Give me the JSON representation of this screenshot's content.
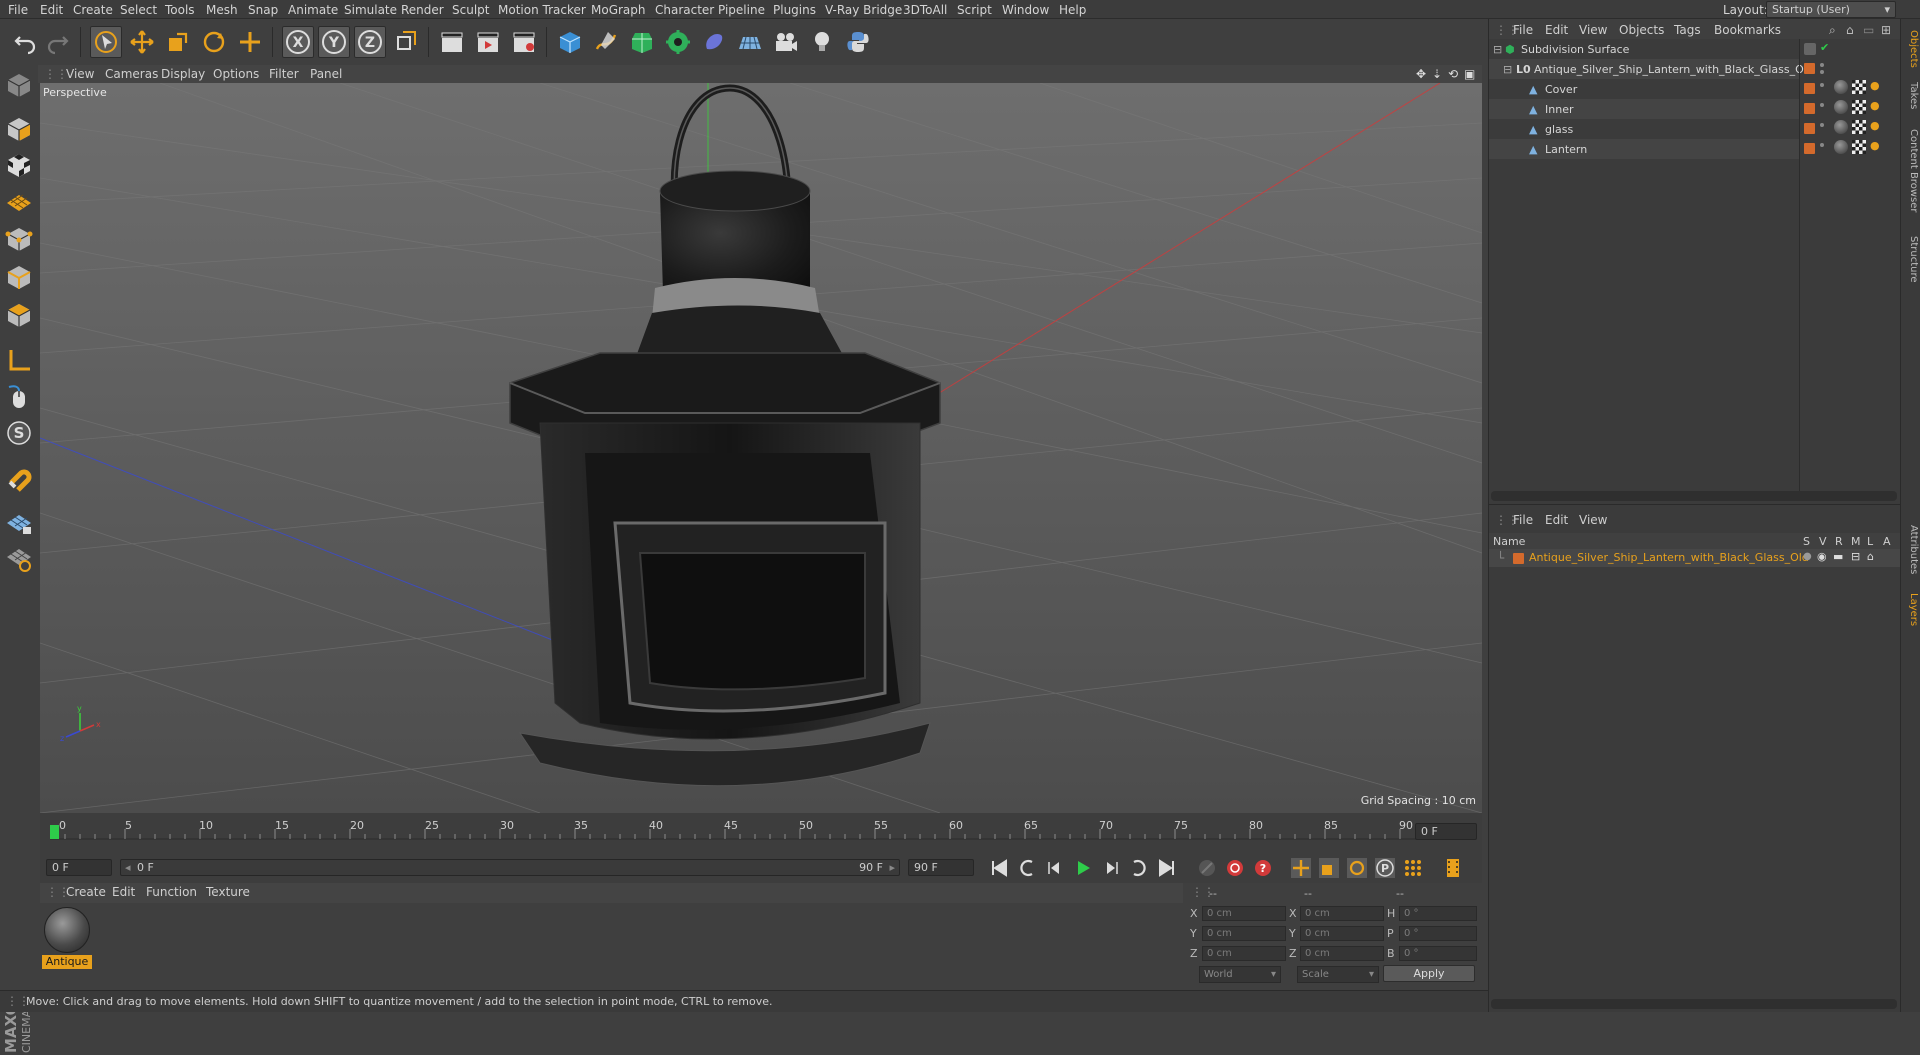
{
  "menu": [
    "File",
    "Edit",
    "Create",
    "Select",
    "Tools",
    "Mesh",
    "Snap",
    "Animate",
    "Simulate",
    "Render",
    "Sculpt",
    "Motion Tracker",
    "MoGraph",
    "Character",
    "Pipeline",
    "Plugins",
    "V-Ray Bridge",
    "3DToAll",
    "Script",
    "Window",
    "Help"
  ],
  "layout": {
    "label": "Layout:",
    "value": "Startup (User)"
  },
  "viewport": {
    "menu": [
      "View",
      "Cameras",
      "Display",
      "Options",
      "Filter",
      "Panel"
    ],
    "label": "Perspective",
    "grid_spacing": "Grid Spacing : 10 cm"
  },
  "timeline": {
    "ticks": [
      "0",
      "5",
      "10",
      "15",
      "20",
      "25",
      "30",
      "35",
      "40",
      "45",
      "50",
      "55",
      "60",
      "65",
      "70",
      "75",
      "80",
      "85",
      "90"
    ],
    "current_frame_field": "0 F",
    "start_field": "0 F",
    "range_start": "0 F",
    "range_end": "90 F",
    "end_field": "90 F"
  },
  "material": {
    "menu": [
      "Create",
      "Edit",
      "Function",
      "Texture"
    ],
    "name": "Antique"
  },
  "coords": {
    "header": [
      "--",
      "--",
      "--"
    ],
    "rows": [
      {
        "a": "X",
        "av": "0 cm",
        "b": "X",
        "bv": "0 cm",
        "c": "H",
        "cv": "0 °"
      },
      {
        "a": "Y",
        "av": "0 cm",
        "b": "Y",
        "bv": "0 cm",
        "c": "P",
        "cv": "0 °"
      },
      {
        "a": "Z",
        "av": "0 cm",
        "b": "Z",
        "bv": "0 cm",
        "c": "B",
        "cv": "0 °"
      }
    ],
    "world": "World",
    "scale": "Scale",
    "apply": "Apply"
  },
  "status": "Move: Click and drag to move elements. Hold down SHIFT to quantize movement / add to the selection in point mode, CTRL to remove.",
  "objects": {
    "menu": [
      "File",
      "Edit",
      "View",
      "Objects",
      "Tags",
      "Bookmarks"
    ],
    "items": [
      {
        "name": "Subdivision Surface"
      },
      {
        "name": "Antique_Silver_Ship_Lantern_with_Black_Glass_Old"
      },
      {
        "name": "Cover"
      },
      {
        "name": "Inner"
      },
      {
        "name": "glass"
      },
      {
        "name": "Lantern"
      }
    ]
  },
  "layers": {
    "menu": [
      "File",
      "Edit",
      "View"
    ],
    "columns": [
      "Name",
      "S",
      "V",
      "R",
      "M",
      "L",
      "A"
    ],
    "row": "Antique_Silver_Ship_Lantern_with_Black_Glass_Old"
  },
  "side_tabs": [
    "Objects",
    "Takes",
    "Content Browser",
    "Structure",
    "Attributes",
    "Layers"
  ],
  "colors": {
    "accent": "#e8a11c",
    "tag_orange": "#d46a2c",
    "axis_x": "#d23a3a",
    "axis_z": "#3a4ad2",
    "axis_y": "#3ad23a"
  }
}
